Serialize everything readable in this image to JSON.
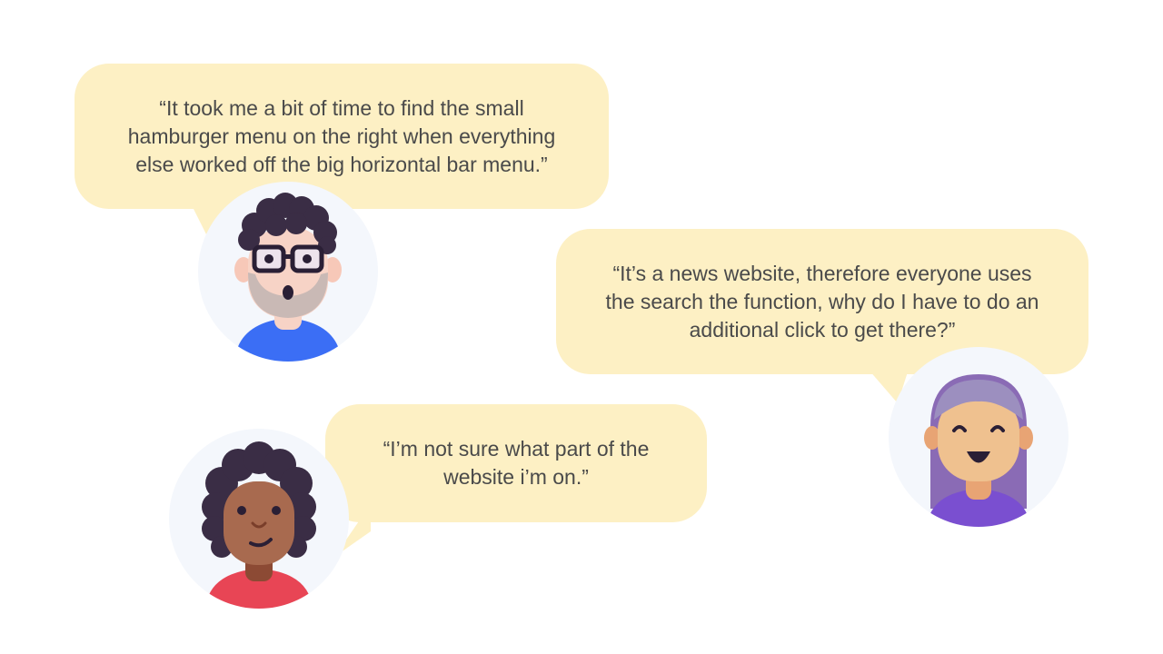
{
  "quotes": [
    {
      "lines": [
        "“It took me a bit of time to find the small",
        "hamburger menu on the right when everything",
        "else worked off the big horizontal bar menu.”"
      ]
    },
    {
      "lines": [
        "“It’s a news website, therefore everyone uses",
        "the search the function, why do I have to do an",
        "additional click to get there?”"
      ]
    },
    {
      "lines": [
        "“I’m not sure what part of the",
        "website i’m on.”"
      ]
    }
  ],
  "colors": {
    "bubble": "#fdf0c4",
    "avatar_bg": "#f4f7fc",
    "text": "#4a4a4a"
  },
  "icons": {
    "avatar_1": "man-with-glasses-surprised-icon",
    "avatar_2": "woman-purple-hair-smiling-icon",
    "avatar_3": "person-curly-hair-smiling-icon"
  }
}
